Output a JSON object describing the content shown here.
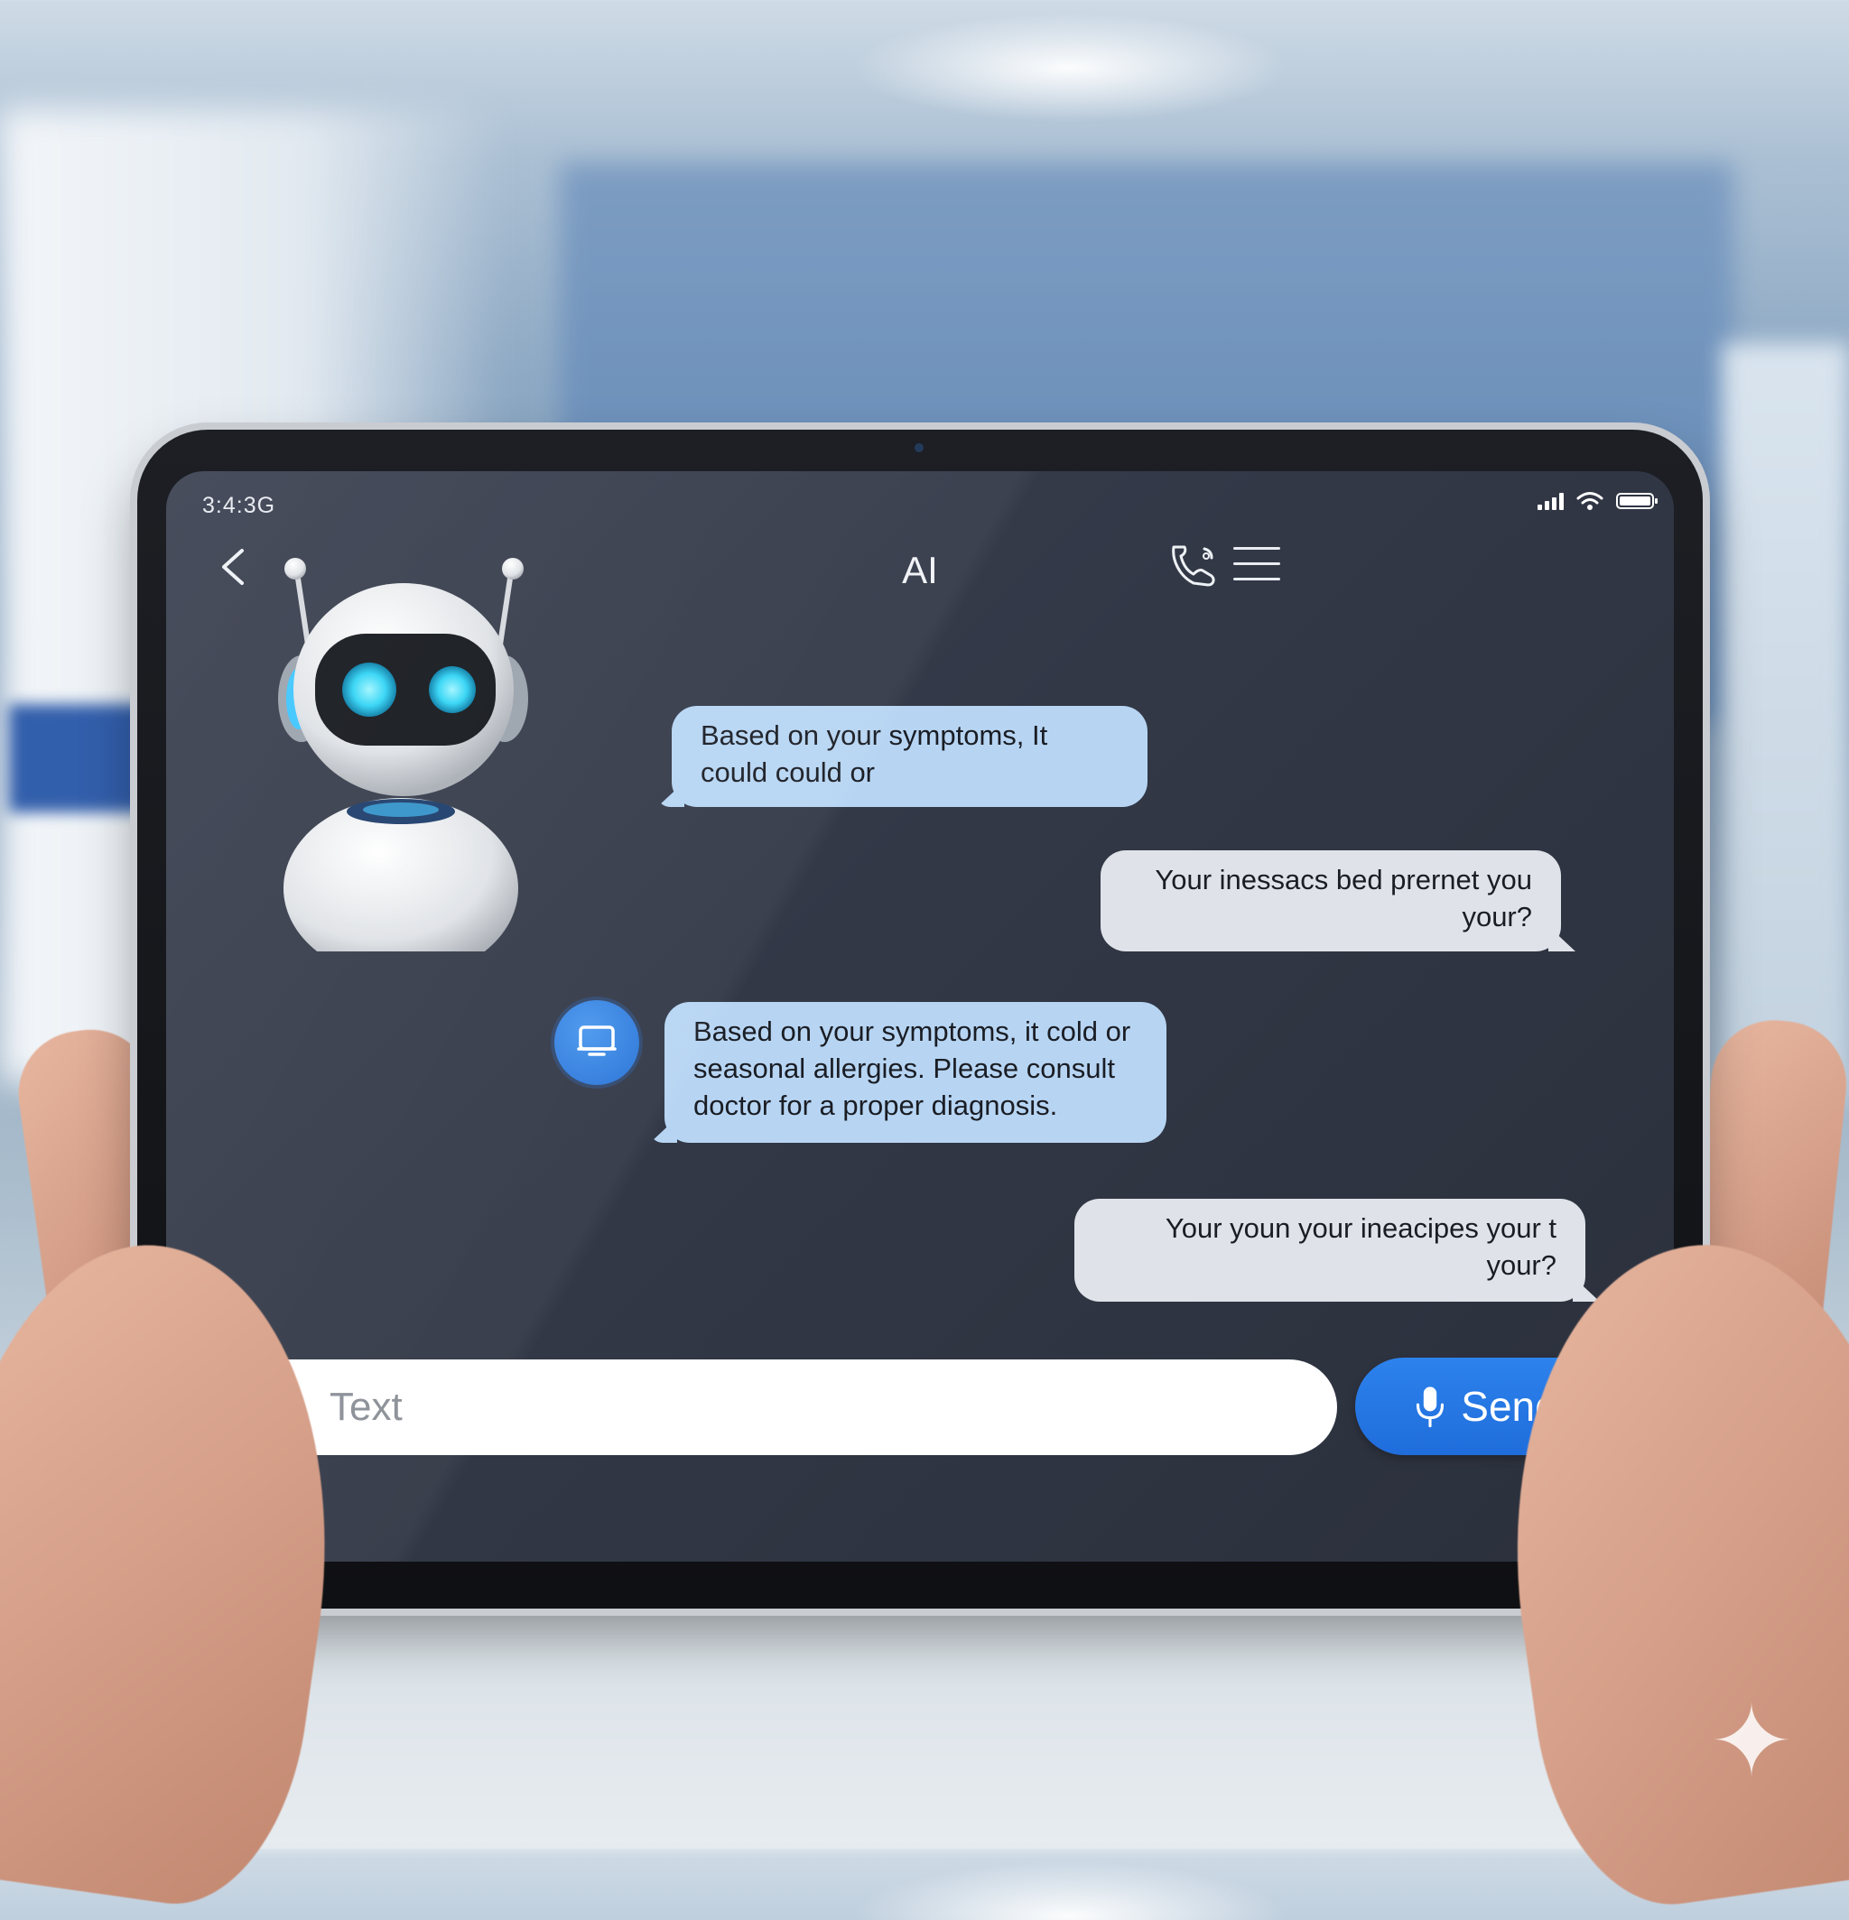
{
  "status_bar": {
    "time": "3:4:3G"
  },
  "header": {
    "title": "AI"
  },
  "messages": [
    {
      "sender": "ai",
      "text": "Based on your symptoms, It could could or"
    },
    {
      "sender": "user",
      "text": "Your inessacs bed prernet you your?"
    },
    {
      "sender": "ai",
      "text": "Based on your symptoms, it cold or seasonal allergies. Please consult doctor for a proper diagnosis."
    },
    {
      "sender": "user",
      "text": "Your youn your ineacipes your t your?"
    }
  ],
  "composer": {
    "placeholder": "Text",
    "send_label": "Send"
  },
  "colors": {
    "screen_bg": "#323846",
    "ai_bubble": "#b7d5f3",
    "user_bubble": "#dfe3e9",
    "accent": "#2378e0"
  },
  "icons": {
    "back": "chevron-left-icon",
    "header_action": "call-icon",
    "menu": "hamburger-menu-icon",
    "composer_mic": "microphone-icon",
    "send_mic": "microphone-icon",
    "ai_avatar": "monitor-icon"
  }
}
